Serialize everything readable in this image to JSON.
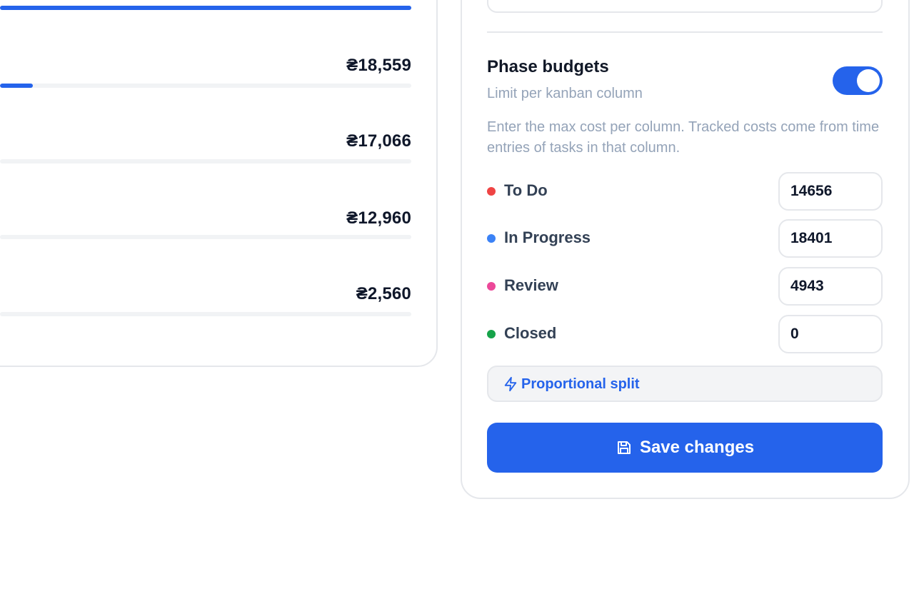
{
  "phases": [
    {
      "amount": "₴18,559",
      "progress": 0.08
    },
    {
      "amount": "₴17,066",
      "progress": 0
    },
    {
      "amount": "₴12,960",
      "progress": 0
    },
    {
      "amount": "₴2,560",
      "progress": 0
    }
  ],
  "top_bar_progress": 1.0,
  "phase_budgets": {
    "title": "Phase budgets",
    "subtitle": "Limit per kanban column",
    "enabled": true,
    "help": "Enter the max cost per column. Tracked costs come from time entries of tasks in that column.",
    "columns": [
      {
        "label": "To Do",
        "value": "14656",
        "color": "#ef4444"
      },
      {
        "label": "In Progress",
        "value": "18401",
        "color": "#3b82f6"
      },
      {
        "label": "Review",
        "value": "4943",
        "color": "#ec4899"
      },
      {
        "label": "Closed",
        "value": "0",
        "color": "#16a34a"
      }
    ],
    "split_label": "Proportional split",
    "split_icon": "lightning-icon",
    "save_label": "Save changes",
    "save_icon": "floppy-disk-icon"
  },
  "colors": {
    "accent": "#2563eb"
  }
}
